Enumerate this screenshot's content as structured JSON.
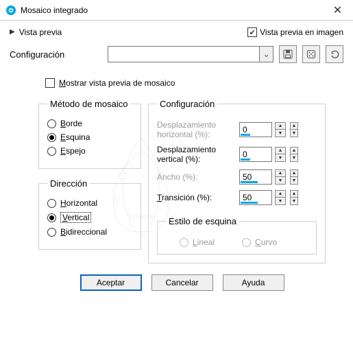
{
  "window": {
    "title": "Mosaico integrado"
  },
  "topbar": {
    "vista_previa": "Vista previa",
    "vista_previa_imagen": "Vista previa en imagen",
    "vista_previa_imagen_checked": true
  },
  "config_row": {
    "label": "Configuración",
    "value": ""
  },
  "show_preview": {
    "prefix": "M",
    "rest": "ostrar vista previa de mosaico",
    "checked": false
  },
  "metodo": {
    "legend": "Método de mosaico",
    "options": [
      {
        "label": "Borde",
        "underline": "B",
        "rest": "orde",
        "selected": false
      },
      {
        "label": "Esquina",
        "underline": "E",
        "rest": "squina",
        "selected": true
      },
      {
        "label": "Espejo",
        "underline": "E",
        "rest": "spejo",
        "selected": false
      }
    ]
  },
  "direccion": {
    "legend": "Dirección",
    "options": [
      {
        "label": "Horizontal",
        "underline": "H",
        "rest": "orizontal",
        "selected": false
      },
      {
        "label": "Vertical",
        "underline": "V",
        "rest": "ertical",
        "selected": true,
        "focused": true
      },
      {
        "label": "Bidireccional",
        "underline": "B",
        "rest": "idireccional",
        "selected": false
      }
    ]
  },
  "conf_panel": {
    "legend": "Configuración",
    "desp_h": {
      "label": "Desplazamiento horizontal (%):",
      "value": "0",
      "enabled": false,
      "bar_pct": 30
    },
    "desp_v": {
      "label": "Desplazamiento vertical (%):",
      "value": "0",
      "enabled": true,
      "bar_pct": 30
    },
    "ancho": {
      "label": "Ancho (%):",
      "value": "50",
      "enabled": false,
      "bar_pct": 55
    },
    "trans": {
      "label": "Transición (%):",
      "value": "50",
      "enabled": true,
      "underline": "T",
      "bar_pct": 55
    }
  },
  "estilo_esquina": {
    "legend": "Estilo de esquina",
    "options": [
      {
        "label": "Lineal",
        "underline": "L",
        "rest": "ineal"
      },
      {
        "label": "Curvo",
        "underline": "C",
        "rest": "urvo"
      }
    ]
  },
  "buttons": {
    "ok": "Aceptar",
    "cancel": "Cancelar",
    "help": "Ayuda"
  }
}
